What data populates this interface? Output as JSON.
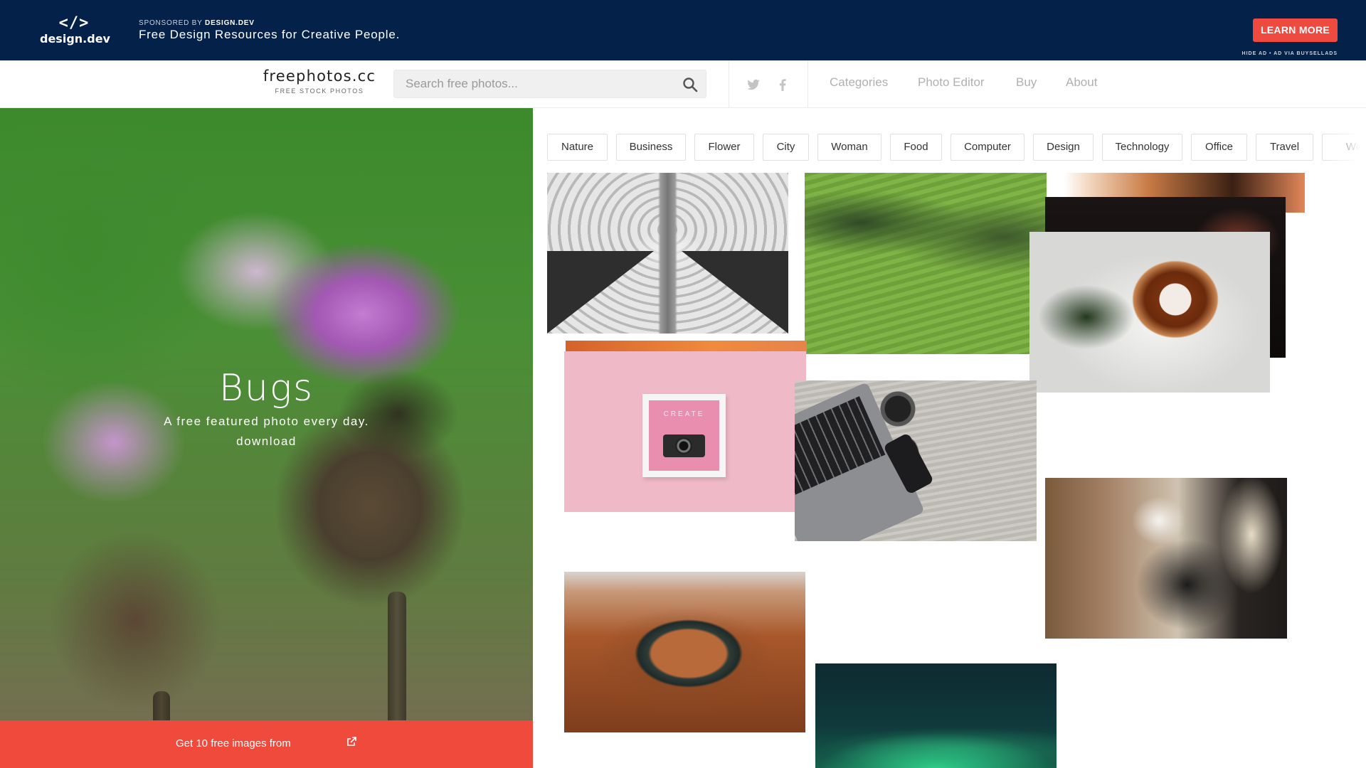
{
  "ad": {
    "logo_mark": "</>",
    "logo_text": "design.dev",
    "sponsor_prefix": "SPONSORED BY",
    "sponsor_name": "DESIGN.DEV",
    "tagline": "Free Design Resources for Creative People.",
    "cta_label": "LEARN MORE",
    "hide_text": "HIDE AD • AD VIA BUYSELLADS",
    "brand_color": "#04214a",
    "cta_color": "#ef4a3f"
  },
  "header": {
    "brand_name": "freephotos.cc",
    "brand_sub": "FREE STOCK PHOTOS",
    "search_placeholder": "Search free photos...",
    "search_icon": "search-icon",
    "social": [
      "twitter-icon",
      "facebook-icon"
    ],
    "nav": [
      {
        "label": "Categories"
      },
      {
        "label": "Photo Editor"
      },
      {
        "label": "Buy"
      },
      {
        "label": "About"
      }
    ]
  },
  "hero": {
    "title": "Bugs",
    "subtitle": "A free featured photo every day.",
    "download_label": "download",
    "cta_text": "Get 10 free images from",
    "cta_icon": "external-link-icon",
    "cta_color": "#f04a3c"
  },
  "categories": [
    {
      "label": "Nature"
    },
    {
      "label": "Business"
    },
    {
      "label": "Flower"
    },
    {
      "label": "City"
    },
    {
      "label": "Woman"
    },
    {
      "label": "Food"
    },
    {
      "label": "Computer"
    },
    {
      "label": "Design"
    },
    {
      "label": "Technology"
    },
    {
      "label": "Office"
    },
    {
      "label": "Travel"
    },
    {
      "label": "Wo"
    }
  ],
  "photos": [
    {
      "subject": "subway escalator"
    },
    {
      "subject": "terraced green hills"
    },
    {
      "subject": "food close-up"
    },
    {
      "subject": "dark food photo"
    },
    {
      "subject": "bagel sandwich"
    },
    {
      "subject": "orange background"
    },
    {
      "subject": "letter board with camera"
    },
    {
      "subject": "laptop and phone on desk"
    },
    {
      "subject": "woman holding cup"
    },
    {
      "subject": "horseshoe bend canyon"
    },
    {
      "subject": "northern lights"
    }
  ]
}
